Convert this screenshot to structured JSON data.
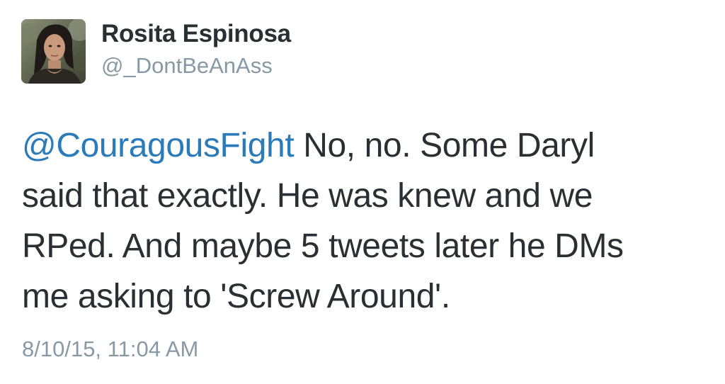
{
  "author": {
    "display_name": "Rosita Espinosa",
    "handle": "@_DontBeAnAss",
    "avatar_icon": "profile-photo"
  },
  "tweet": {
    "mention": "@CouragousFight",
    "line1_rest": " No, no. Some Daryl",
    "line2": "said that exactly. He was knew and we",
    "line3": "RPed. And maybe 5 tweets later he DMs",
    "line4": "me asking to 'Screw Around'."
  },
  "timestamp": "8/10/15, 11:04 AM",
  "colors": {
    "text": "#292f33",
    "mention": "#2b7bb9",
    "secondary": "#8899a6"
  }
}
